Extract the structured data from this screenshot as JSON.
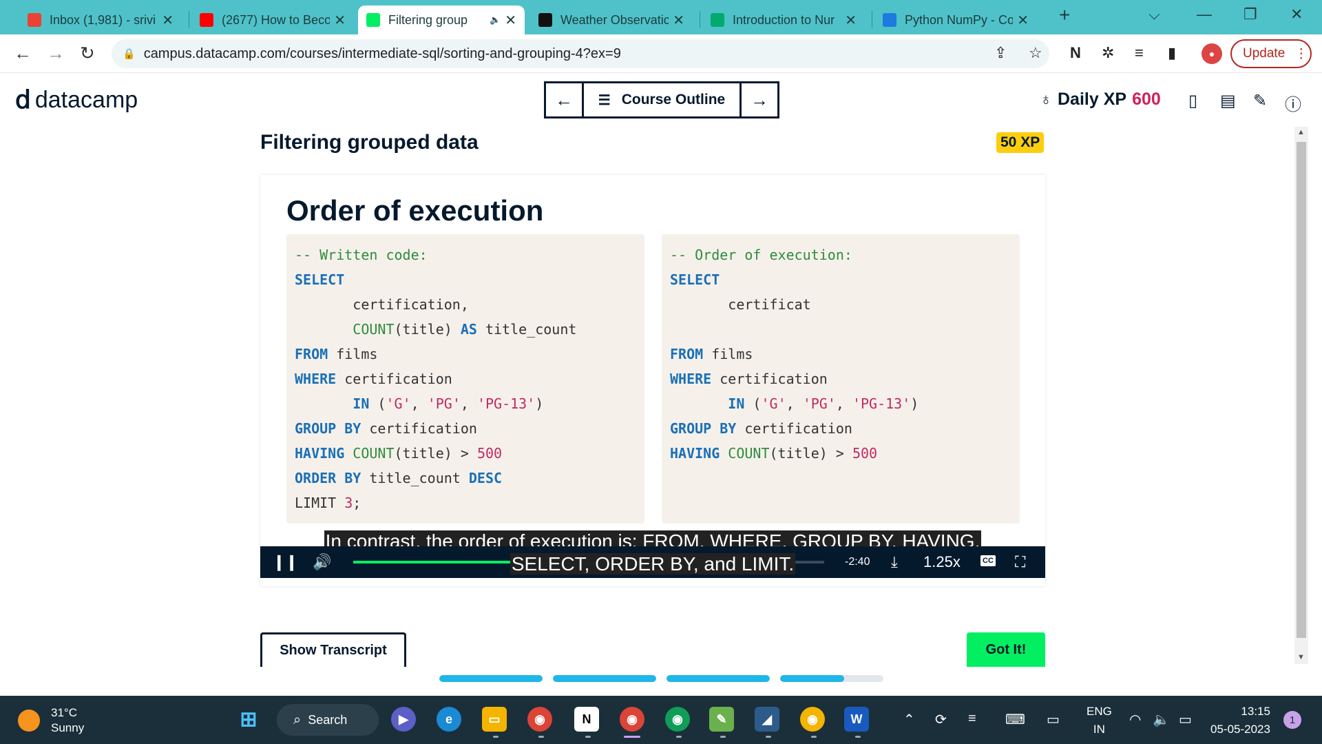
{
  "browser": {
    "tabs": [
      {
        "title": "Inbox (1,981) - srivi",
        "icon": "gmail-icon",
        "color": "#ea4335",
        "glyph": "M"
      },
      {
        "title": "(2677) How to Beco",
        "icon": "youtube-icon",
        "color": "#ff0000",
        "glyph": "▶"
      },
      {
        "title": "Filtering group",
        "icon": "datacamp-icon",
        "color": "#03ef62",
        "glyph": "d",
        "active": true,
        "audio": "🔈"
      },
      {
        "title": "Weather Observatic",
        "icon": "kaggle-icon",
        "color": "#111111",
        "glyph": "H"
      },
      {
        "title": "Introduction to Nur",
        "icon": "w3-icon",
        "color": "#04aa6d",
        "glyph": "W"
      },
      {
        "title": "Python NumPy - Co",
        "icon": "code-icon",
        "color": "#1f7ae0",
        "glyph": "ϟ"
      }
    ],
    "new_tab": "+",
    "url": "campus.datacamp.com/courses/intermediate-sql/sorting-and-grouping-4?ex=9",
    "update_label": "Update"
  },
  "header": {
    "logo_text": "datacamp",
    "course_outline": "Course Outline",
    "daily_xp_label": "Daily XP",
    "daily_xp_value": "600"
  },
  "exercise": {
    "title": "Filtering grouped data",
    "xp_badge": "50 XP"
  },
  "slide": {
    "heading": "Order of execution",
    "left_code": [
      [
        {
          "t": "-- Written code:",
          "c": "cm"
        }
      ],
      [
        {
          "t": "SELECT",
          "c": "kw"
        }
      ],
      [
        {
          "t": "       certification,",
          "c": ""
        }
      ],
      [
        {
          "t": "       ",
          "c": ""
        },
        {
          "t": "COUNT",
          "c": "fn"
        },
        {
          "t": "(title) ",
          "c": ""
        },
        {
          "t": "AS",
          "c": "kw"
        },
        {
          "t": " title_count",
          "c": ""
        }
      ],
      [
        {
          "t": "FROM",
          "c": "kw"
        },
        {
          "t": " films",
          "c": ""
        }
      ],
      [
        {
          "t": "WHERE",
          "c": "kw"
        },
        {
          "t": " certification",
          "c": ""
        }
      ],
      [
        {
          "t": "       ",
          "c": ""
        },
        {
          "t": "IN",
          "c": "kw"
        },
        {
          "t": " (",
          "c": ""
        },
        {
          "t": "'G'",
          "c": "st"
        },
        {
          "t": ", ",
          "c": ""
        },
        {
          "t": "'PG'",
          "c": "st"
        },
        {
          "t": ", ",
          "c": ""
        },
        {
          "t": "'PG-13'",
          "c": "st"
        },
        {
          "t": ")",
          "c": ""
        }
      ],
      [
        {
          "t": "GROUP BY",
          "c": "kw"
        },
        {
          "t": " certification",
          "c": ""
        }
      ],
      [
        {
          "t": "HAVING",
          "c": "kw"
        },
        {
          "t": " ",
          "c": ""
        },
        {
          "t": "COUNT",
          "c": "fn"
        },
        {
          "t": "(title) > ",
          "c": ""
        },
        {
          "t": "500",
          "c": "nm"
        }
      ],
      [
        {
          "t": "ORDER BY",
          "c": "kw"
        },
        {
          "t": " title_count ",
          "c": ""
        },
        {
          "t": "DESC",
          "c": "kw"
        }
      ],
      [
        {
          "t": "LIMIT ",
          "c": ""
        },
        {
          "t": "3",
          "c": "nm"
        },
        {
          "t": ";",
          "c": ""
        }
      ]
    ],
    "right_code": [
      [
        {
          "t": "-- Order of execution:",
          "c": "cm"
        }
      ],
      [
        {
          "t": "SELECT",
          "c": "kw"
        }
      ],
      [
        {
          "t": "       certificat",
          "c": ""
        }
      ],
      [
        {
          "t": "",
          "c": ""
        }
      ],
      [
        {
          "t": "FROM",
          "c": "kw"
        },
        {
          "t": " films",
          "c": ""
        }
      ],
      [
        {
          "t": "WHERE",
          "c": "kw"
        },
        {
          "t": " certification",
          "c": ""
        }
      ],
      [
        {
          "t": "       ",
          "c": ""
        },
        {
          "t": "IN",
          "c": "kw"
        },
        {
          "t": " (",
          "c": ""
        },
        {
          "t": "'G'",
          "c": "st"
        },
        {
          "t": ", ",
          "c": ""
        },
        {
          "t": "'PG'",
          "c": "st"
        },
        {
          "t": ", ",
          "c": ""
        },
        {
          "t": "'PG-13'",
          "c": "st"
        },
        {
          "t": ")",
          "c": ""
        }
      ],
      [
        {
          "t": "GROUP BY",
          "c": "kw"
        },
        {
          "t": " certification",
          "c": ""
        }
      ],
      [
        {
          "t": "HAVING",
          "c": "kw"
        },
        {
          "t": " ",
          "c": ""
        },
        {
          "t": "COUNT",
          "c": "fn"
        },
        {
          "t": "(title) > ",
          "c": ""
        },
        {
          "t": "500",
          "c": "nm"
        }
      ]
    ],
    "caption_line1": "In contrast, the order of execution is: FROM, WHERE, GROUP BY, HAVING,",
    "caption_line2": "SELECT, ORDER BY, and LIMIT."
  },
  "player": {
    "progress_fraction": 0.366,
    "buffered_fraction": 0.86,
    "time_remaining": "-2:40",
    "playback_rate": "1.25x",
    "cc_label": "CC"
  },
  "actions": {
    "show_transcript": "Show Transcript",
    "got_it": "Got It!"
  },
  "course_progress": [
    1.0,
    1.0,
    1.0,
    0.62
  ],
  "taskbar": {
    "temperature": "31°C",
    "condition": "Sunny",
    "search_label": "Search",
    "lang_1": "ENG",
    "lang_2": "IN",
    "time": "13:15",
    "date": "05-05-2023",
    "notification_count": "1"
  }
}
